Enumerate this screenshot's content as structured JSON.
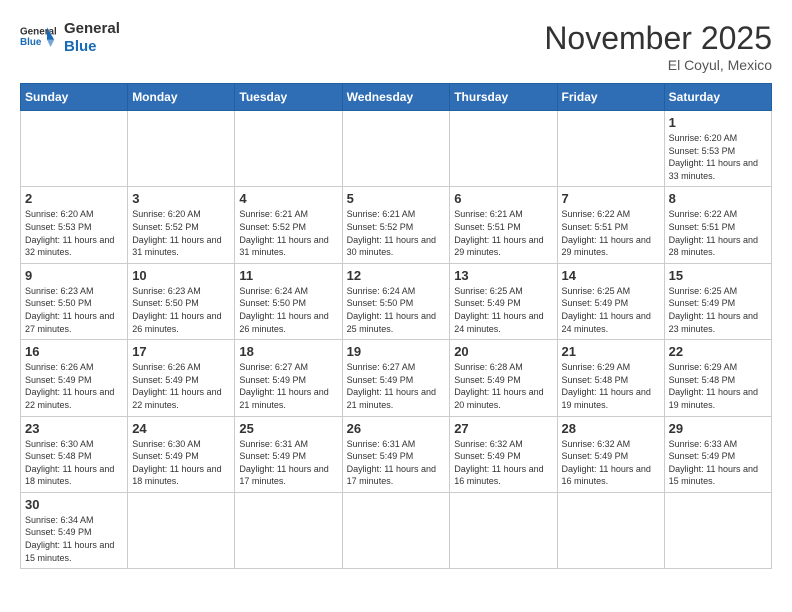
{
  "header": {
    "logo_general": "General",
    "logo_blue": "Blue",
    "month_title": "November 2025",
    "location": "El Coyul, Mexico"
  },
  "weekdays": [
    "Sunday",
    "Monday",
    "Tuesday",
    "Wednesday",
    "Thursday",
    "Friday",
    "Saturday"
  ],
  "days": {
    "1": {
      "sunrise": "6:20 AM",
      "sunset": "5:53 PM",
      "daylight": "11 hours and 33 minutes."
    },
    "2": {
      "sunrise": "6:20 AM",
      "sunset": "5:53 PM",
      "daylight": "11 hours and 32 minutes."
    },
    "3": {
      "sunrise": "6:20 AM",
      "sunset": "5:52 PM",
      "daylight": "11 hours and 31 minutes."
    },
    "4": {
      "sunrise": "6:21 AM",
      "sunset": "5:52 PM",
      "daylight": "11 hours and 31 minutes."
    },
    "5": {
      "sunrise": "6:21 AM",
      "sunset": "5:52 PM",
      "daylight": "11 hours and 30 minutes."
    },
    "6": {
      "sunrise": "6:21 AM",
      "sunset": "5:51 PM",
      "daylight": "11 hours and 29 minutes."
    },
    "7": {
      "sunrise": "6:22 AM",
      "sunset": "5:51 PM",
      "daylight": "11 hours and 29 minutes."
    },
    "8": {
      "sunrise": "6:22 AM",
      "sunset": "5:51 PM",
      "daylight": "11 hours and 28 minutes."
    },
    "9": {
      "sunrise": "6:23 AM",
      "sunset": "5:50 PM",
      "daylight": "11 hours and 27 minutes."
    },
    "10": {
      "sunrise": "6:23 AM",
      "sunset": "5:50 PM",
      "daylight": "11 hours and 26 minutes."
    },
    "11": {
      "sunrise": "6:24 AM",
      "sunset": "5:50 PM",
      "daylight": "11 hours and 26 minutes."
    },
    "12": {
      "sunrise": "6:24 AM",
      "sunset": "5:50 PM",
      "daylight": "11 hours and 25 minutes."
    },
    "13": {
      "sunrise": "6:25 AM",
      "sunset": "5:49 PM",
      "daylight": "11 hours and 24 minutes."
    },
    "14": {
      "sunrise": "6:25 AM",
      "sunset": "5:49 PM",
      "daylight": "11 hours and 24 minutes."
    },
    "15": {
      "sunrise": "6:25 AM",
      "sunset": "5:49 PM",
      "daylight": "11 hours and 23 minutes."
    },
    "16": {
      "sunrise": "6:26 AM",
      "sunset": "5:49 PM",
      "daylight": "11 hours and 22 minutes."
    },
    "17": {
      "sunrise": "6:26 AM",
      "sunset": "5:49 PM",
      "daylight": "11 hours and 22 minutes."
    },
    "18": {
      "sunrise": "6:27 AM",
      "sunset": "5:49 PM",
      "daylight": "11 hours and 21 minutes."
    },
    "19": {
      "sunrise": "6:27 AM",
      "sunset": "5:49 PM",
      "daylight": "11 hours and 21 minutes."
    },
    "20": {
      "sunrise": "6:28 AM",
      "sunset": "5:49 PM",
      "daylight": "11 hours and 20 minutes."
    },
    "21": {
      "sunrise": "6:29 AM",
      "sunset": "5:48 PM",
      "daylight": "11 hours and 19 minutes."
    },
    "22": {
      "sunrise": "6:29 AM",
      "sunset": "5:48 PM",
      "daylight": "11 hours and 19 minutes."
    },
    "23": {
      "sunrise": "6:30 AM",
      "sunset": "5:48 PM",
      "daylight": "11 hours and 18 minutes."
    },
    "24": {
      "sunrise": "6:30 AM",
      "sunset": "5:49 PM",
      "daylight": "11 hours and 18 minutes."
    },
    "25": {
      "sunrise": "6:31 AM",
      "sunset": "5:49 PM",
      "daylight": "11 hours and 17 minutes."
    },
    "26": {
      "sunrise": "6:31 AM",
      "sunset": "5:49 PM",
      "daylight": "11 hours and 17 minutes."
    },
    "27": {
      "sunrise": "6:32 AM",
      "sunset": "5:49 PM",
      "daylight": "11 hours and 16 minutes."
    },
    "28": {
      "sunrise": "6:32 AM",
      "sunset": "5:49 PM",
      "daylight": "11 hours and 16 minutes."
    },
    "29": {
      "sunrise": "6:33 AM",
      "sunset": "5:49 PM",
      "daylight": "11 hours and 15 minutes."
    },
    "30": {
      "sunrise": "6:34 AM",
      "sunset": "5:49 PM",
      "daylight": "11 hours and 15 minutes."
    }
  }
}
